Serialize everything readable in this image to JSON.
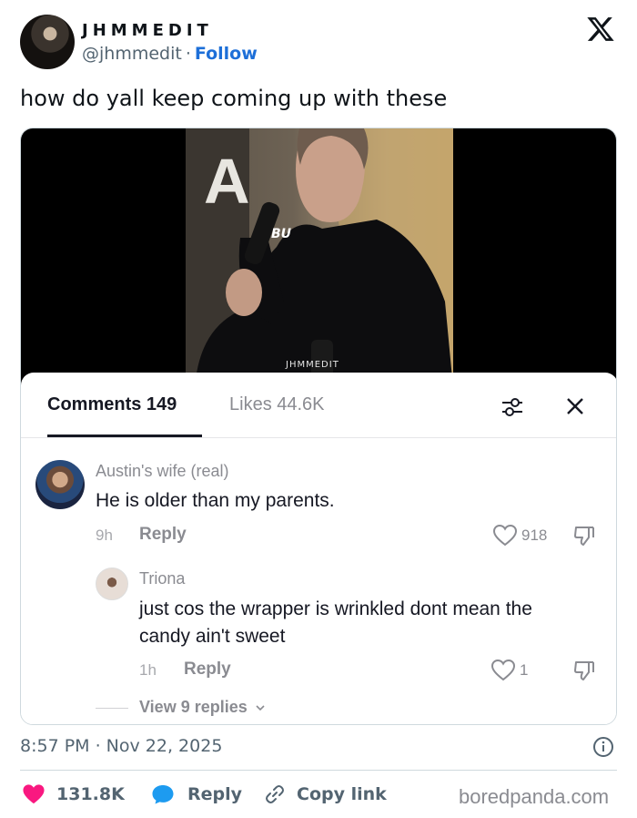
{
  "tweet": {
    "author_name": "JHMMEDIT",
    "handle": "@jhmmedit",
    "separator": "·",
    "follow_label": "Follow",
    "text": "how do yall keep coming up with these",
    "timestamp": "8:57 PM · Nov 22, 2025"
  },
  "video": {
    "sign_letter": "A",
    "shirt_text": "BU",
    "watermark": "JHMMEDIT"
  },
  "comments_panel": {
    "tab_comments": "Comments 149",
    "tab_likes": "Likes 44.6K",
    "comments": [
      {
        "name": "Austin's wife (real)",
        "text": "He is older than my parents.",
        "time": "9h",
        "reply_label": "Reply",
        "likes": "918"
      },
      {
        "name": "Triona",
        "text_line1": "just cos the wrapper is wrinkled dont mean the",
        "text_line2": "candy ain't sweet",
        "time": "1h",
        "reply_label": "Reply",
        "likes": "1"
      }
    ],
    "view_replies": "View 9 replies"
  },
  "footer": {
    "likes": "131.8K",
    "reply_label": "Reply",
    "copy_link_label": "Copy link"
  },
  "brand": "boredpanda.com",
  "icons": {
    "x_logo": "x-logo-icon",
    "filter": "sliders-icon",
    "close": "close-icon",
    "heart": "heart-icon",
    "dislike": "thumbs-down-icon",
    "info": "info-icon",
    "reply": "speech-bubble-icon",
    "link": "link-icon"
  },
  "colors": {
    "follow_blue": "#1d6fd8",
    "heart_pink": "#f91880",
    "reply_blue": "#1d9bf0",
    "text_dark": "#0f1419",
    "text_gray": "#536471"
  }
}
